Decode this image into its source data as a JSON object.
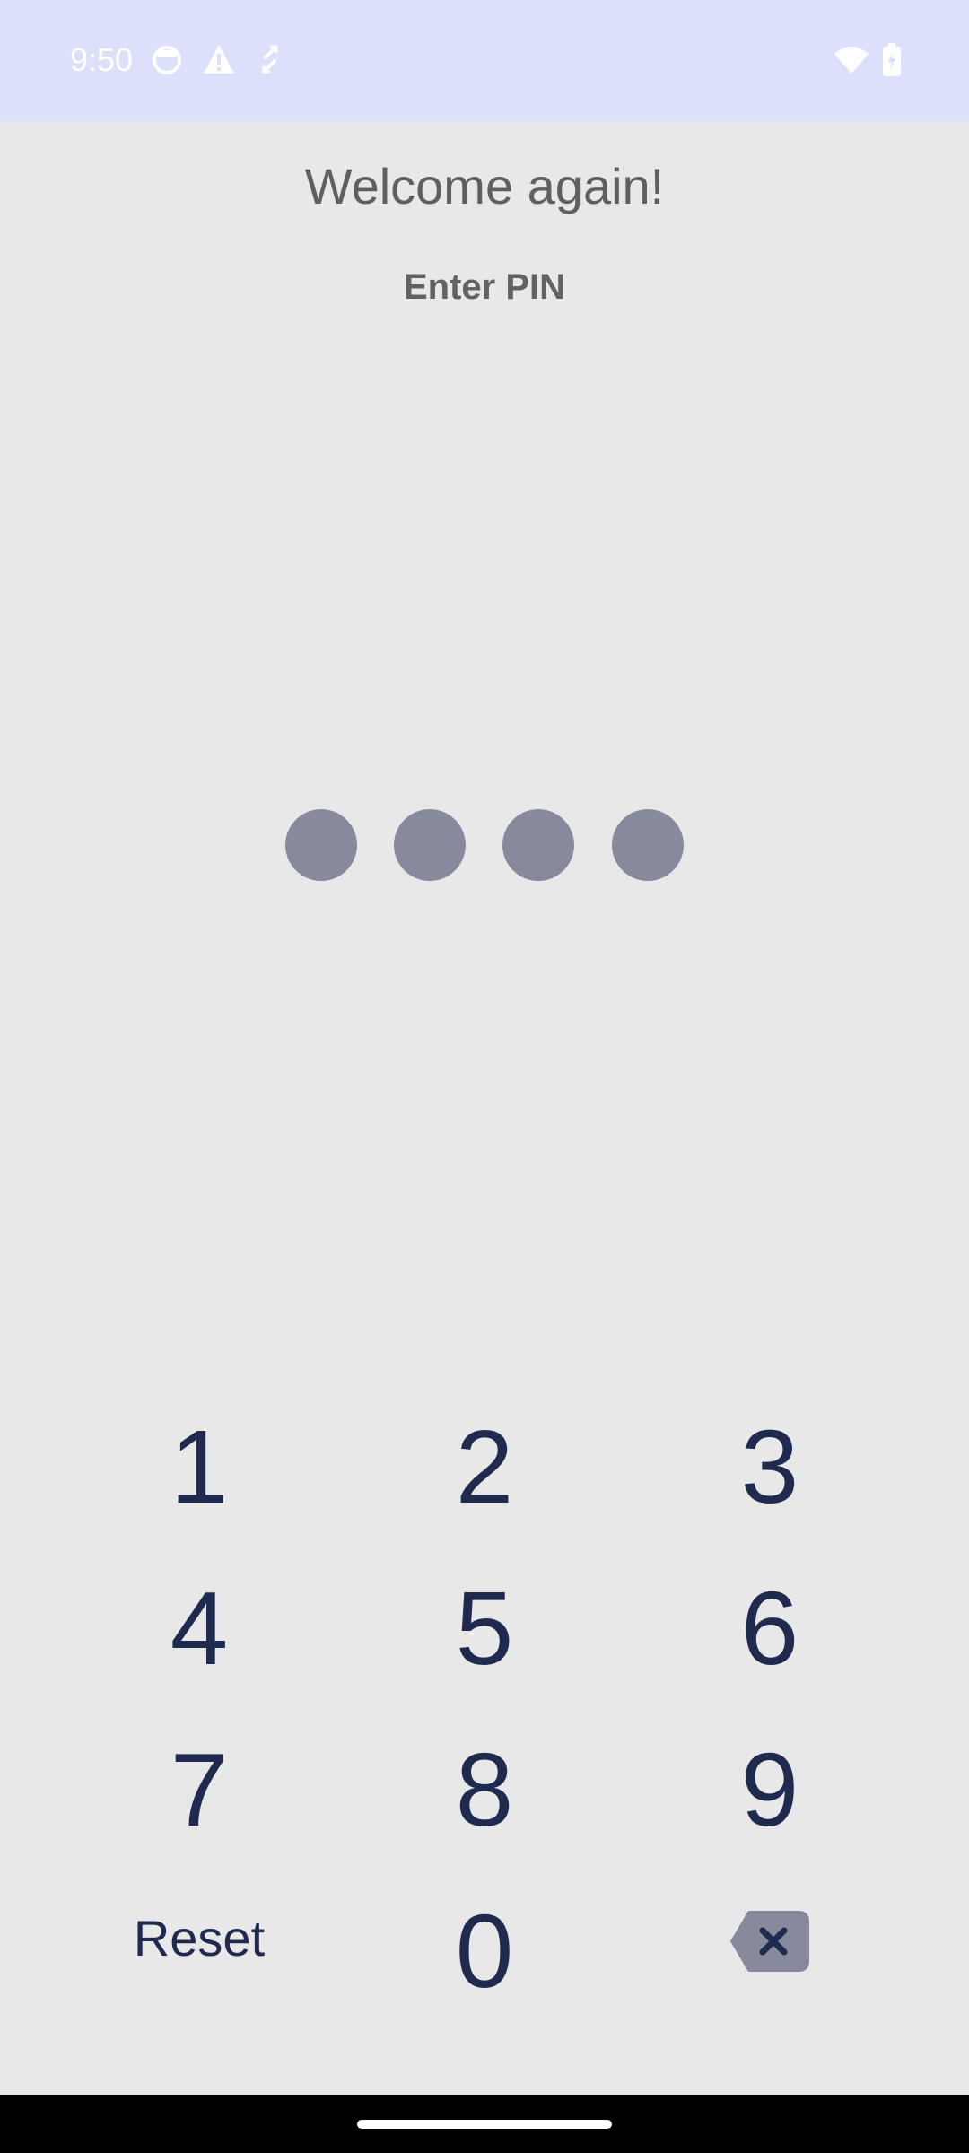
{
  "status_bar": {
    "time": "9:50",
    "left_icons": [
      "face-icon",
      "alert-icon",
      "sync-icon"
    ],
    "right_icons": [
      "wifi-icon",
      "battery-charging-icon"
    ],
    "background": "#dde0fb"
  },
  "screen": {
    "title": "Welcome again!",
    "subtitle": "Enter PIN",
    "pin_length": 4,
    "pin_dot_color": "#868a9c"
  },
  "keypad": {
    "keys": [
      "1",
      "2",
      "3",
      "4",
      "5",
      "6",
      "7",
      "8",
      "9"
    ],
    "reset_label": "Reset",
    "zero_label": "0",
    "backspace_icon": "backspace-icon",
    "key_color": "#1f2a4f"
  },
  "nav_bar": {
    "handle_icon": "home-handle"
  }
}
